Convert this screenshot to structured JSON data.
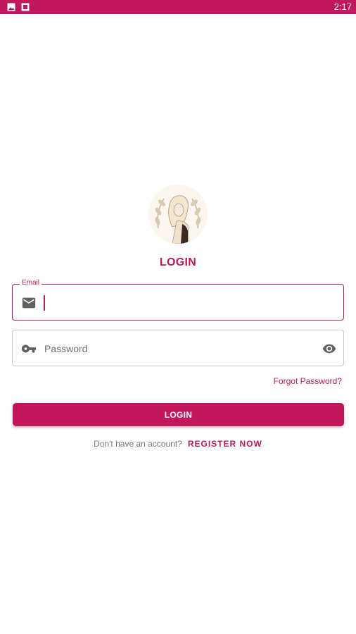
{
  "status_bar": {
    "time": "2:17",
    "icons": [
      "image-icon",
      "photo-icon"
    ]
  },
  "logo": {
    "icon": "woman-laurel-illustration"
  },
  "login_title": "LOGIN",
  "email_field": {
    "label": "Email",
    "value": "",
    "icon": "mail-icon"
  },
  "password_field": {
    "placeholder": "Password",
    "icon": "key-icon",
    "toggle_icon": "eye-icon"
  },
  "forgot_password": "Forgot Password?",
  "login_button": "LOGIN",
  "register": {
    "prompt": "Don't have an account?",
    "link": "REGISTER NOW"
  },
  "colors": {
    "primary": "#c2185b",
    "background": "#ffffff"
  }
}
